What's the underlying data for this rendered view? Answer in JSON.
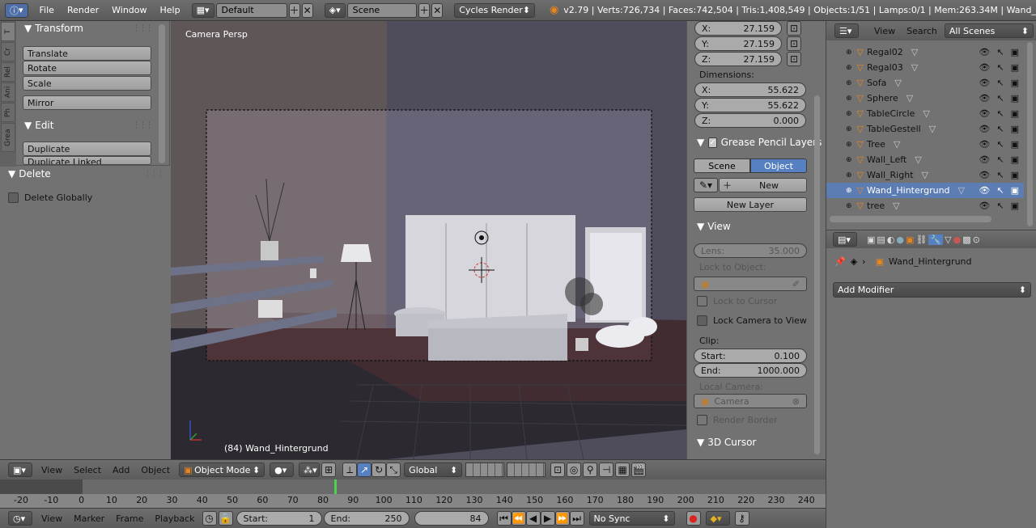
{
  "topbar": {
    "menus": [
      "File",
      "Render",
      "Window",
      "Help"
    ],
    "layout_value": "Default",
    "scene_value": "Scene",
    "engine_value": "Cycles Render",
    "stats": "v2.79 | Verts:726,734 | Faces:742,504 | Tris:1,408,549 | Objects:1/51 | Lamps:0/1 | Mem:263.34M | Wand_"
  },
  "toolshelf": {
    "tabs": [
      "T",
      "Cr",
      "Rel",
      "Ani",
      "Ph",
      "Grea"
    ],
    "transform_header": "Transform",
    "transform_buttons": [
      "Translate",
      "Rotate",
      "Scale"
    ],
    "mirror_button": "Mirror",
    "edit_header": "Edit",
    "edit_buttons": [
      "Duplicate",
      "Duplicate Linked"
    ],
    "delete_header": "Delete",
    "delete_globally": "Delete Globally"
  },
  "viewport": {
    "label": "Camera Persp",
    "object_label": "(84) Wand_Hintergrund"
  },
  "npanel": {
    "loc": [
      {
        "axis": "X:",
        "value": "27.159"
      },
      {
        "axis": "Y:",
        "value": "27.159"
      },
      {
        "axis": "Z:",
        "value": "27.159"
      }
    ],
    "dimensions_label": "Dimensions:",
    "dims": [
      {
        "axis": "X:",
        "value": "55.622"
      },
      {
        "axis": "Y:",
        "value": "55.622"
      },
      {
        "axis": "Z:",
        "value": "0.000"
      }
    ],
    "gp_header": "Grease Pencil Layers",
    "gp_tabs": [
      "Scene",
      "Object"
    ],
    "gp_new": "New",
    "gp_new_layer": "New Layer",
    "view_header": "View",
    "lens_label": "Lens:",
    "lens_value": "35.000",
    "lock_to_object": "Lock to Object:",
    "lock_to_cursor": "Lock to Cursor",
    "lock_camera": "Lock Camera to View",
    "clip_label": "Clip:",
    "clip_start_label": "Start:",
    "clip_start": "0.100",
    "clip_end_label": "End:",
    "clip_end": "1000.000",
    "local_camera_label": "Local Camera:",
    "local_camera": "Camera",
    "render_border": "Render Border",
    "cursor_header": "3D Cursor"
  },
  "outliner": {
    "view": "View",
    "search": "Search",
    "filter": "All Scenes",
    "rows": [
      {
        "name": "Regal02",
        "selected": false
      },
      {
        "name": "Regal03",
        "selected": false
      },
      {
        "name": "Sofa",
        "selected": false
      },
      {
        "name": "Sphere",
        "selected": false
      },
      {
        "name": "TableCircle",
        "selected": false
      },
      {
        "name": "TableGestell",
        "selected": false
      },
      {
        "name": "Tree",
        "selected": false
      },
      {
        "name": "Wall_Left",
        "selected": false
      },
      {
        "name": "Wall_Right",
        "selected": false
      },
      {
        "name": "Wand_Hintergrund",
        "selected": true
      },
      {
        "name": "tree",
        "selected": false
      }
    ]
  },
  "properties": {
    "object_name": "Wand_Hintergrund",
    "add_modifier": "Add Modifier"
  },
  "view3d_header": {
    "menus": [
      "View",
      "Select",
      "Add",
      "Object"
    ],
    "mode": "Object Mode",
    "orientation": "Global"
  },
  "timeline": {
    "ticks": [
      "-20",
      "-10",
      "0",
      "10",
      "20",
      "30",
      "40",
      "50",
      "60",
      "70",
      "80",
      "90",
      "100",
      "110",
      "120",
      "130",
      "140",
      "150",
      "160",
      "170",
      "180",
      "190",
      "200",
      "210",
      "220",
      "230",
      "240"
    ],
    "current_frame": 84
  },
  "timeline_header": {
    "menus": [
      "View",
      "Marker",
      "Frame",
      "Playback"
    ],
    "start_label": "Start:",
    "start_value": "1",
    "end_label": "End:",
    "end_value": "250",
    "current": "84",
    "sync": "No Sync"
  },
  "colors": {
    "accent_blue": "#5680c2",
    "selected_row": "#5c7db3",
    "orange_icon": "#e8861e"
  }
}
